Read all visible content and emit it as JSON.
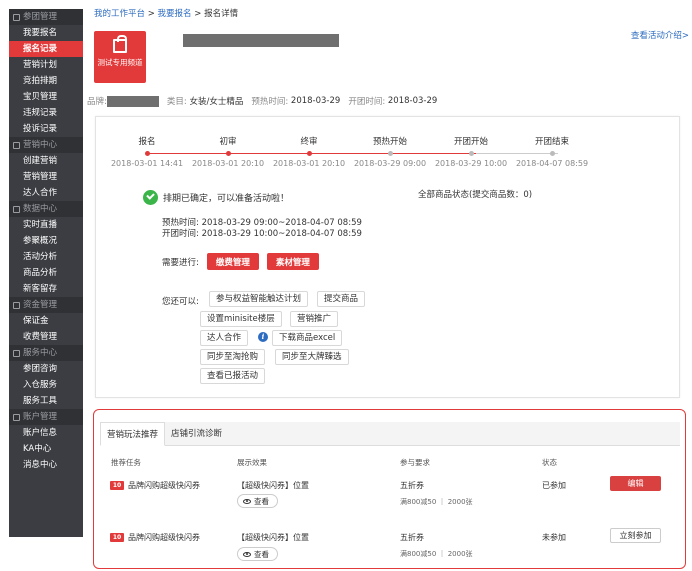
{
  "sidebar": {
    "groups": [
      {
        "title": "参团管理",
        "items": [
          "我要报名",
          "报名记录",
          "营销计划",
          "竞拍排期",
          "宝贝管理",
          "违规记录",
          "投诉记录"
        ]
      },
      {
        "title": "营销中心",
        "items": [
          "创建营销",
          "营销管理",
          "达人合作"
        ]
      },
      {
        "title": "数据中心",
        "items": [
          "实时直播",
          "参聚概况",
          "活动分析",
          "商品分析",
          "新客留存"
        ]
      },
      {
        "title": "资金管理",
        "items": [
          "保证金",
          "收费管理"
        ]
      },
      {
        "title": "服务中心",
        "items": [
          "参团咨询",
          "入仓服务",
          "服务工具"
        ]
      },
      {
        "title": "账户管理",
        "items": [
          "账户信息",
          "KA中心",
          "消息中心"
        ]
      }
    ],
    "active_item": "报名记录"
  },
  "breadcrumb": {
    "home": "我的工作平台",
    "sep": " > ",
    "mid": "我要报名",
    "current": "报名详情"
  },
  "top_link": "查看活动介绍>",
  "logo_text": "测试专用频道",
  "meta": {
    "brand_label": "品牌:",
    "category_label": "类目:",
    "category_value": "女装/女士精品",
    "preheat_label": "预热时间:",
    "preheat_value": "2018-03-29",
    "group_label": "开团时间:",
    "group_value": "2018-03-29"
  },
  "timeline": {
    "steps": [
      {
        "label": "报名",
        "date": "2018-03-01 14:41",
        "done": true
      },
      {
        "label": "初审",
        "date": "2018-03-01 20:10",
        "done": true
      },
      {
        "label": "终审",
        "date": "2018-03-01 20:10",
        "done": true
      },
      {
        "label": "预热开始",
        "date": "2018-03-29 09:00",
        "done": false
      },
      {
        "label": "开团开始",
        "date": "2018-03-29 10:00",
        "done": false
      },
      {
        "label": "开团结束",
        "date": "2018-04-07 08:59",
        "done": false
      }
    ]
  },
  "status": {
    "message": "排期已确定，可以准备活动啦！",
    "goods_status": "全部商品状态(提交商品数：0)",
    "preheat_time": "预热时间: 2018-03-29 09:00~2018-04-07 08:59",
    "group_time": "开团时间: 2018-03-29 10:00~2018-04-07 08:59"
  },
  "need": {
    "label": "需要进行:",
    "buttons": [
      "缴费管理",
      "素材管理"
    ]
  },
  "also": {
    "label": "您还可以:",
    "buttons": [
      "参与权益智能触达计划",
      "提交商品",
      "设置minisite楼层",
      "营销推广",
      "达人合作",
      "下载商品excel",
      "同步至淘抢购",
      "同步至大牌臻选",
      "查看已报活动"
    ]
  },
  "tabs": [
    "营销玩法推荐",
    "店铺引流诊断"
  ],
  "table": {
    "headers": [
      "推荐任务",
      "展示效果",
      "参与要求",
      "状态"
    ],
    "rows": [
      {
        "icon": "10",
        "name": "品牌闪购超级快闪券",
        "effect": "【超级快闪券】位置",
        "view": "查看",
        "req": "五折券",
        "req_detail": "满800减50 ｜ 2000张",
        "state": "已参加",
        "action": "编辑"
      },
      {
        "icon": "10",
        "name": "品牌闪购超级快闪券",
        "effect": "【超级快闪券】位置",
        "view": "查看",
        "req": "五折券",
        "req_detail": "满800减50 ｜ 2000张",
        "state": "未参加",
        "action": "立刻参加"
      }
    ]
  }
}
